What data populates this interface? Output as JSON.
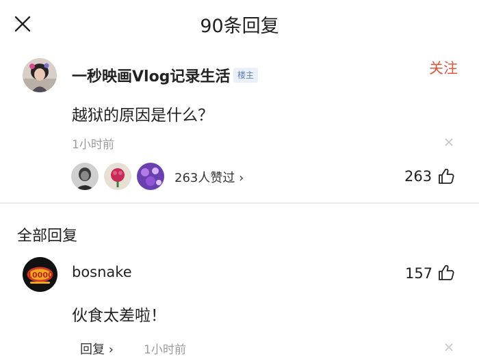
{
  "header": {
    "title": "90条回复",
    "close_icon": "close-icon"
  },
  "post": {
    "author": "一秒映画Vlog记录生活",
    "badge": "楼主",
    "follow_label": "关注",
    "text": "越狱的原因是什么？",
    "time": "1小时前",
    "likers_summary": "263人赞过 ›",
    "like_count": "263",
    "colors": {
      "follow": "#e0553e",
      "badge_text": "#5d7fb1"
    }
  },
  "replies_section": {
    "title": "全部回复"
  },
  "reply": {
    "author": "bosnake",
    "like_count": "157",
    "text": "伙食太差啦！",
    "reply_label": "回复 ›",
    "time": "1小时前",
    "avatar_text": "10000"
  }
}
